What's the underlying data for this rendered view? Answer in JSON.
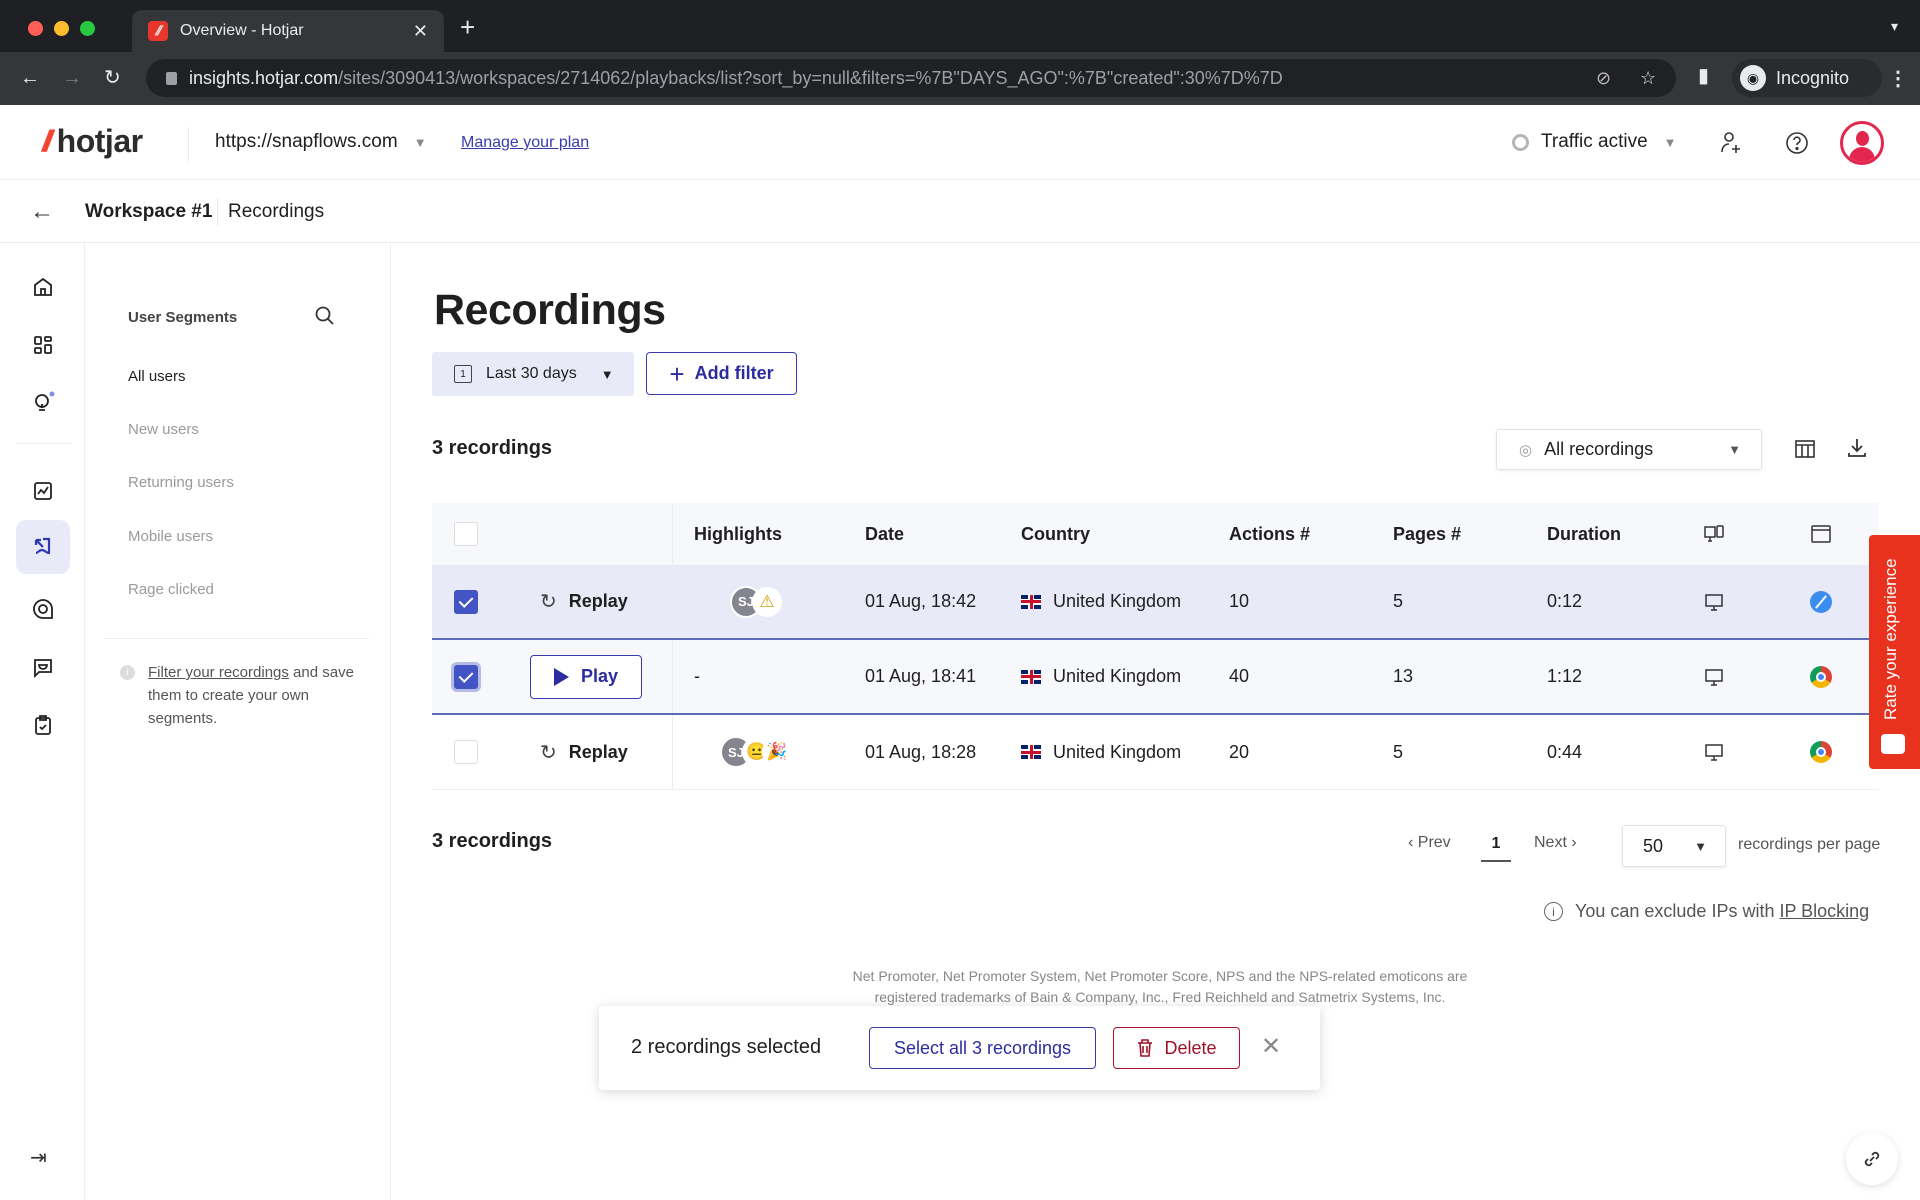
{
  "browser": {
    "tab_title": "Overview - Hotjar",
    "url_host": "insights.hotjar.com",
    "url_path": "/sites/3090413/workspaces/2714062/playbacks/list?sort_by=null&filters=%7B\"DAYS_AGO\":%7B\"created\":30%7D%7D",
    "profile_label": "Incognito"
  },
  "header": {
    "logo_text": "hotjar",
    "site": "https://snapflows.com",
    "plan_link": "Manage your plan",
    "traffic_status": "Traffic active"
  },
  "breadcrumb": {
    "workspace": "Workspace #1",
    "page": "Recordings"
  },
  "segments": {
    "title": "User Segments",
    "items": [
      {
        "label": "All users",
        "active": true
      },
      {
        "label": "New users",
        "active": false
      },
      {
        "label": "Returning users",
        "active": false
      },
      {
        "label": "Mobile users",
        "active": false
      },
      {
        "label": "Rage clicked",
        "active": false
      }
    ],
    "info_link": "Filter your recordings",
    "info_text": " and save them to create your own segments."
  },
  "main": {
    "title": "Recordings",
    "date_filter": "Last 30 days",
    "date_icon_digit": "1",
    "add_filter": "Add filter",
    "count_label": "3 recordings",
    "view_select": "All recordings"
  },
  "table": {
    "headers": {
      "highlights": "Highlights",
      "date": "Date",
      "country": "Country",
      "actions": "Actions #",
      "pages": "Pages #",
      "duration": "Duration"
    },
    "rows": [
      {
        "selected": true,
        "action": "Replay",
        "highlights_avatar": "SJ",
        "highlights_emojis": [
          "⚠"
        ],
        "date": "01 Aug, 18:42",
        "country": "United Kingdom",
        "actions": "10",
        "pages": "5",
        "duration": "0:12",
        "device": "desktop",
        "browser": "safari"
      },
      {
        "selected": true,
        "action": "Play",
        "highlights_text": "-",
        "date": "01 Aug, 18:41",
        "country": "United Kingdom",
        "actions": "40",
        "pages": "13",
        "duration": "1:12",
        "device": "desktop",
        "browser": "chrome"
      },
      {
        "selected": false,
        "action": "Replay",
        "highlights_avatar": "SJ",
        "highlights_emojis": [
          "😐",
          "🎉"
        ],
        "date": "01 Aug, 18:28",
        "country": "United Kingdom",
        "actions": "20",
        "pages": "5",
        "duration": "0:44",
        "device": "desktop",
        "browser": "chrome"
      }
    ]
  },
  "pagination": {
    "count_label": "3 recordings",
    "prev": "Prev",
    "page": "1",
    "next": "Next",
    "per_page": "50",
    "per_page_label": "recordings per page"
  },
  "ip_note": {
    "text": "You can exclude IPs with",
    "link": "IP Blocking"
  },
  "legal": "Net Promoter, Net Promoter System, Net Promoter Score, NPS and the NPS-related emoticons are registered trademarks of Bain & Company, Inc., Fred Reichheld and Satmetrix Systems, Inc.",
  "bulk_bar": {
    "selected_label": "2 recordings selected",
    "select_all": "Select all 3 recordings",
    "delete": "Delete"
  },
  "feedback_tab": "Rate your experience",
  "colors": {
    "brand": "#f4442e",
    "primary": "#3b3bb0",
    "selected_row": "#e8eaf7",
    "danger": "#b0142e",
    "feedback": "#e8321e"
  }
}
